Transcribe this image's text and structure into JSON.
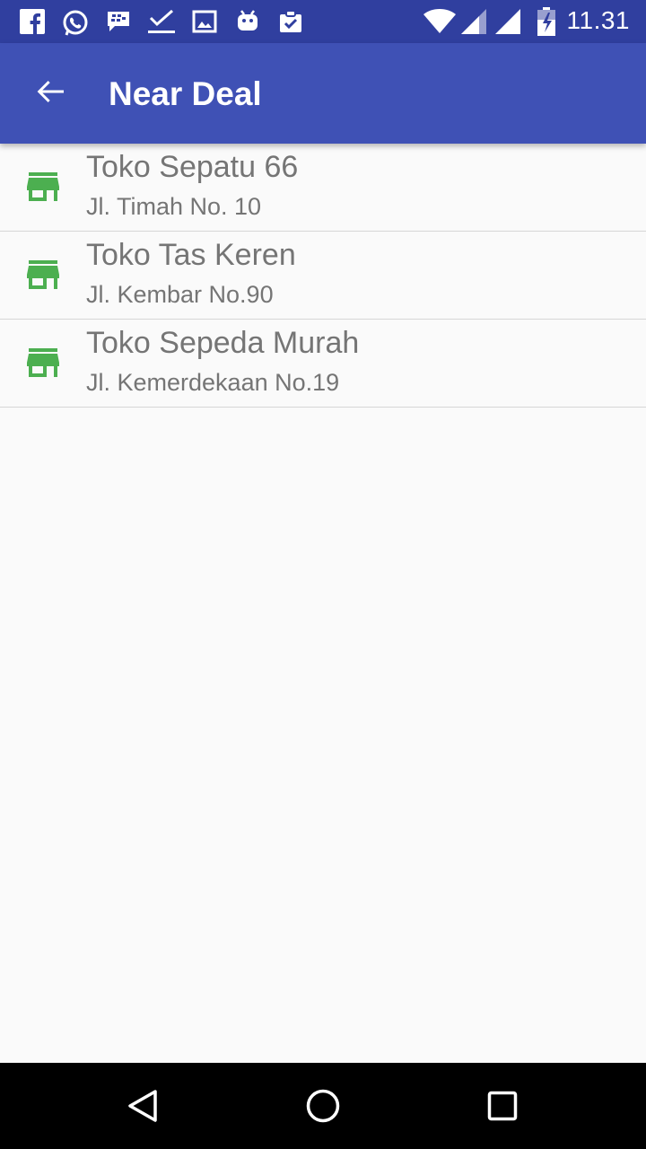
{
  "status_bar": {
    "time": "11.31",
    "icons": [
      "facebook-icon",
      "whatsapp-icon",
      "bbm-icon",
      "check-icon",
      "image-icon",
      "android-icon",
      "clipboard-check-icon",
      "wifi-icon",
      "signal-icon",
      "signal-icon",
      "battery-charging-icon"
    ]
  },
  "app_bar": {
    "title": "Near Deal",
    "back_icon": "arrow-back-icon",
    "background": "#3f51b5",
    "status_background": "#303f9f"
  },
  "stores": [
    {
      "name": "Toko Sepatu 66",
      "address": "Jl. Timah No. 10",
      "icon": "store-icon"
    },
    {
      "name": "Toko Tas Keren",
      "address": "Jl. Kembar No.90",
      "icon": "store-icon"
    },
    {
      "name": "Toko Sepeda Murah",
      "address": "Jl. Kemerdekaan No.19",
      "icon": "store-icon"
    }
  ],
  "colors": {
    "store_icon": "#4caf50",
    "text": "#757575"
  },
  "nav_bar": {
    "buttons": [
      "back-triangle-icon",
      "home-circle-icon",
      "recents-square-icon"
    ]
  }
}
